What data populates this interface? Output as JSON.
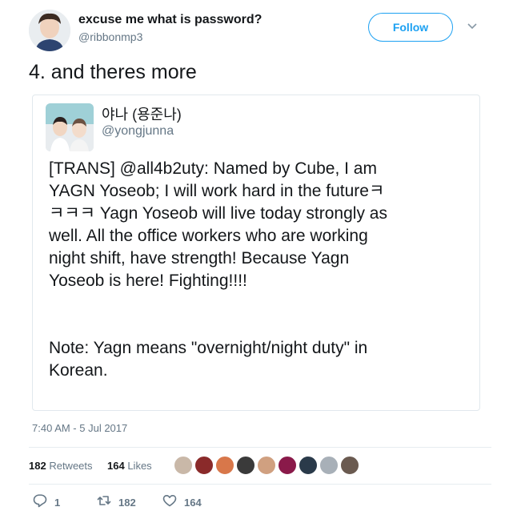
{
  "tweet": {
    "display_name": "excuse me what is password?",
    "handle": "@ribbonmp3",
    "follow_label": "Follow",
    "text": "4. and theres more",
    "timestamp": "7:40 AM - 5 Jul 2017"
  },
  "quote": {
    "display_name": "야나 (용준나)",
    "handle": "@yongjunna",
    "body": "[TRANS] @all4b2uty: Named by Cube, I am\nYAGN Yoseob; I will work hard in the futureㅋ\nㅋㅋㅋ Yagn Yoseob will live today strongly as\nwell. All the office workers who are working\nnight shift, have strength! Because Yagn\nYoseob is here! Fighting!!!!\n\n\nNote: Yagn means \"overnight/night duty\" in\nKorean."
  },
  "stats": {
    "retweets_count": "182",
    "retweets_label": "Retweets",
    "likes_count": "164",
    "likes_label": "Likes"
  },
  "actions": {
    "reply_count": "1",
    "retweet_count": "182",
    "like_count": "164"
  },
  "colors": {
    "accent": "#1da1f2",
    "muted": "#657786",
    "text": "#14171a"
  },
  "liker_avatars": [
    "#c9b8a8",
    "#8a2a2a",
    "#d8774a",
    "#3a3a3a",
    "#d0a080",
    "#8a1a4a",
    "#2a3a4a",
    "#a8b0b8",
    "#6a5a50"
  ]
}
